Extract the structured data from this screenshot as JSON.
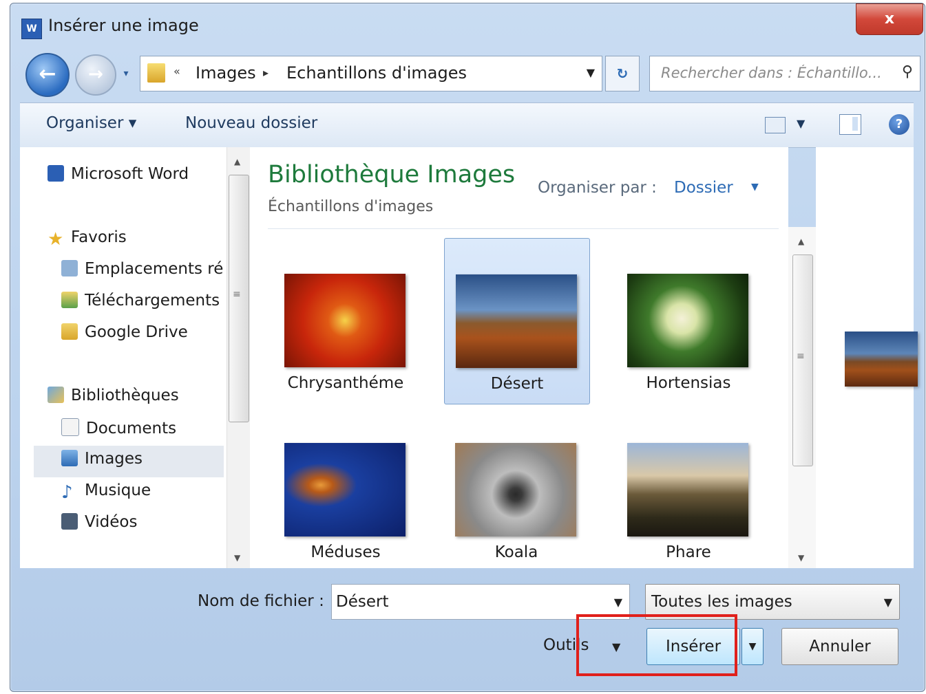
{
  "window": {
    "title": "Insérer une image",
    "app_icon": "W",
    "close_symbol": "x"
  },
  "navigation": {
    "back_symbol": "←",
    "forward_symbol": "→",
    "breadcrumb_chevrons": "«",
    "breadcrumb": [
      "Images",
      "Echantillons d'images"
    ],
    "refresh_symbol": "↻",
    "search_placeholder": "Rechercher dans : Échantillo..."
  },
  "toolbar": {
    "organize_label": "Organiser ▾",
    "new_folder_label": "Nouveau dossier",
    "help_symbol": "?"
  },
  "sidebar": {
    "items": [
      {
        "label": "Microsoft Word",
        "icon": "word-icon"
      },
      {
        "label": "Favoris",
        "icon": "star-icon"
      },
      {
        "label": "Emplacements récents",
        "icon": "recent-places-icon"
      },
      {
        "label": "Téléchargements",
        "icon": "downloads-icon"
      },
      {
        "label": "Google Drive",
        "icon": "google-drive-icon"
      },
      {
        "label": "Bibliothèques",
        "icon": "libraries-icon"
      },
      {
        "label": "Documents",
        "icon": "documents-icon"
      },
      {
        "label": "Images",
        "icon": "pictures-icon"
      },
      {
        "label": "Musique",
        "icon": "music-icon"
      },
      {
        "label": "Vidéos",
        "icon": "videos-icon"
      }
    ],
    "selected": "Images"
  },
  "library": {
    "title": "Bibliothèque Images",
    "subtitle": "Échantillons d'images",
    "arrange_by_label": "Organiser par :",
    "arrange_by_value": "Dossier"
  },
  "files": [
    {
      "name": "Chrysanthéme",
      "selected": false
    },
    {
      "name": "Désert",
      "selected": true
    },
    {
      "name": "Hortensias",
      "selected": false
    },
    {
      "name": "Méduses",
      "selected": false
    },
    {
      "name": "Koala",
      "selected": false
    },
    {
      "name": "Phare",
      "selected": false
    }
  ],
  "footer": {
    "filename_label": "Nom de fichier :",
    "filename_value": "Désert",
    "filter_value": "Toutes les images",
    "tools_label": "Outils",
    "insert_label": "Insérer",
    "cancel_label": "Annuler"
  },
  "colors": {
    "library_title": "#1e7a3c",
    "highlight": "#e0201b",
    "selection": "#c9dcf5"
  }
}
